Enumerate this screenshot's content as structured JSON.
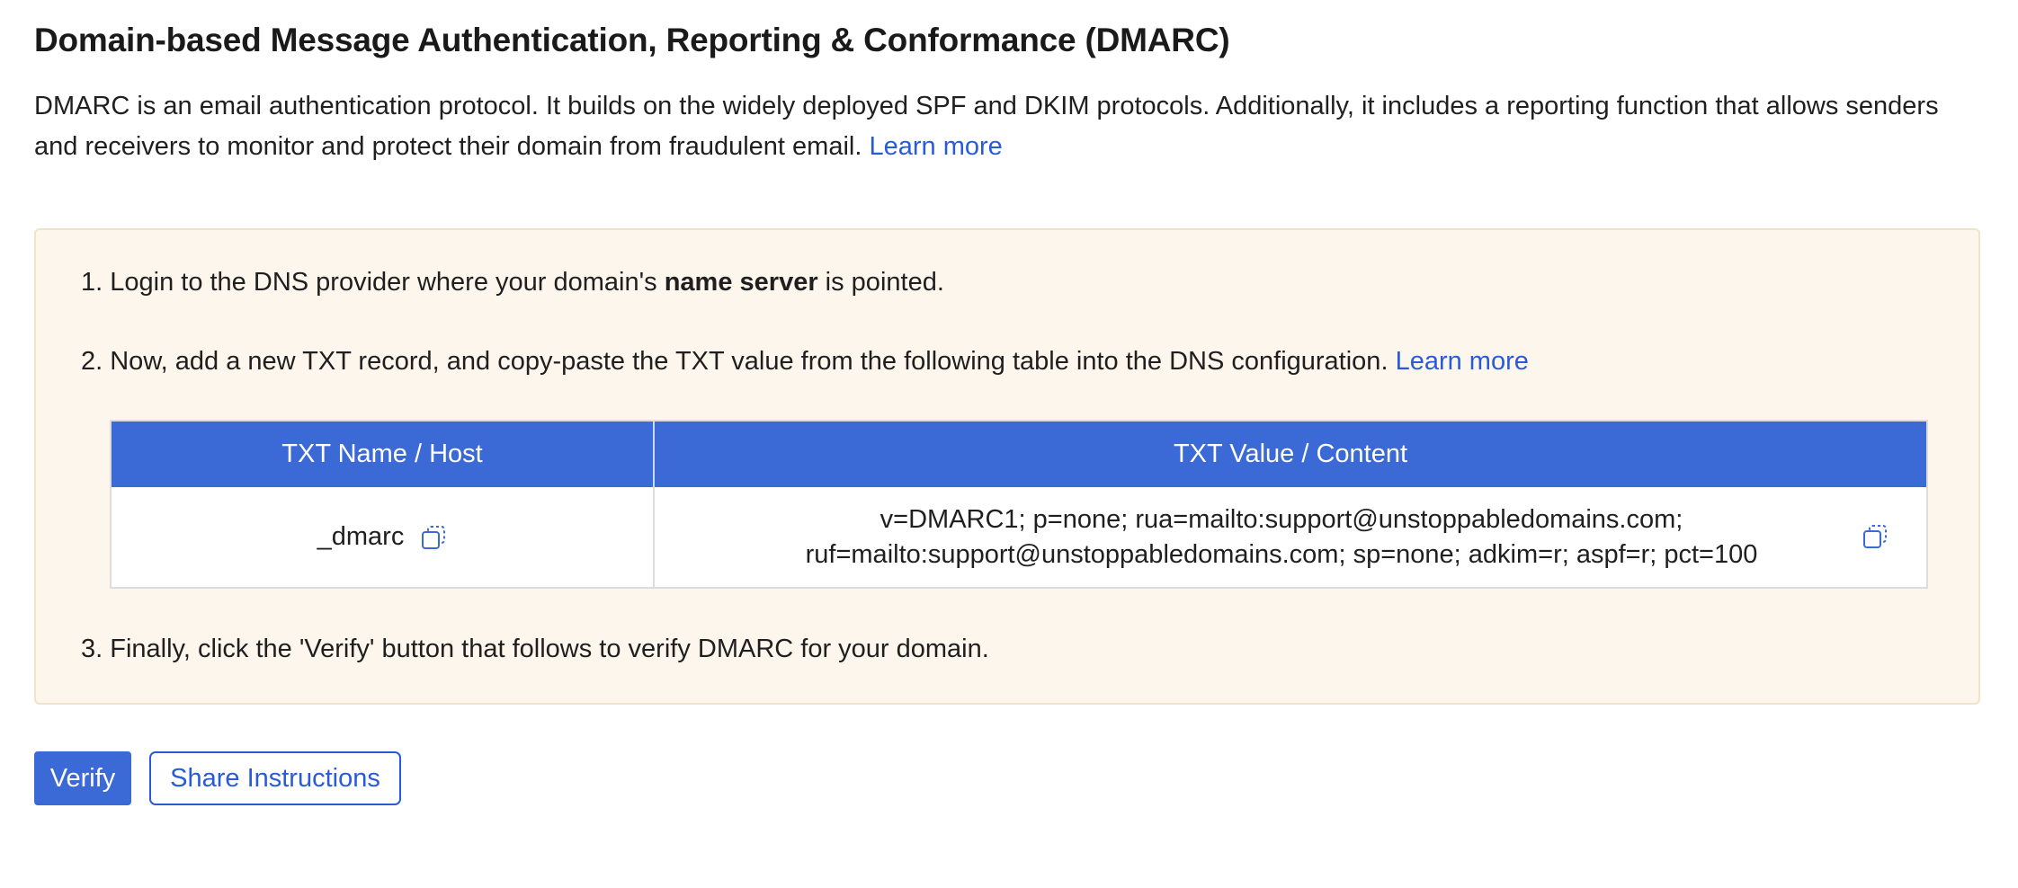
{
  "header": {
    "title": "Domain-based Message Authentication, Reporting & Conformance (DMARC)",
    "description": "DMARC is an email authentication protocol. It builds on the widely deployed SPF and DKIM protocols. Additionally, it includes a reporting function that allows senders and receivers to monitor and protect their domain from fraudulent email.",
    "learn_more": "Learn more"
  },
  "steps": {
    "step1_prefix": "1. Login to the DNS provider where your domain's ",
    "step1_bold": "name server",
    "step1_suffix": " is pointed.",
    "step2_text": "2. Now, add a new TXT record, and copy-paste the TXT value from the following table into the DNS configuration.",
    "step2_link": "Learn more",
    "step3_text": "3. Finally, click the 'Verify' button that follows to verify DMARC for your domain."
  },
  "table": {
    "headers": [
      "TXT Name / Host",
      "TXT Value / Content"
    ],
    "rows": [
      {
        "name": "_dmarc",
        "value_line1": "v=DMARC1; p=none; rua=mailto:support@unstoppabledomains.com;",
        "value_line2": "ruf=mailto:support@unstoppabledomains.com; sp=none; adkim=r; aspf=r; pct=100"
      }
    ]
  },
  "actions": {
    "verify_label": "Verify",
    "share_label": "Share Instructions"
  },
  "icons": {
    "copy": "copy-icon"
  },
  "colors": {
    "accent": "#3b69d6",
    "link": "#2a5bd7",
    "panel_bg": "#fdf6ec",
    "panel_border": "#f1e3c8"
  }
}
